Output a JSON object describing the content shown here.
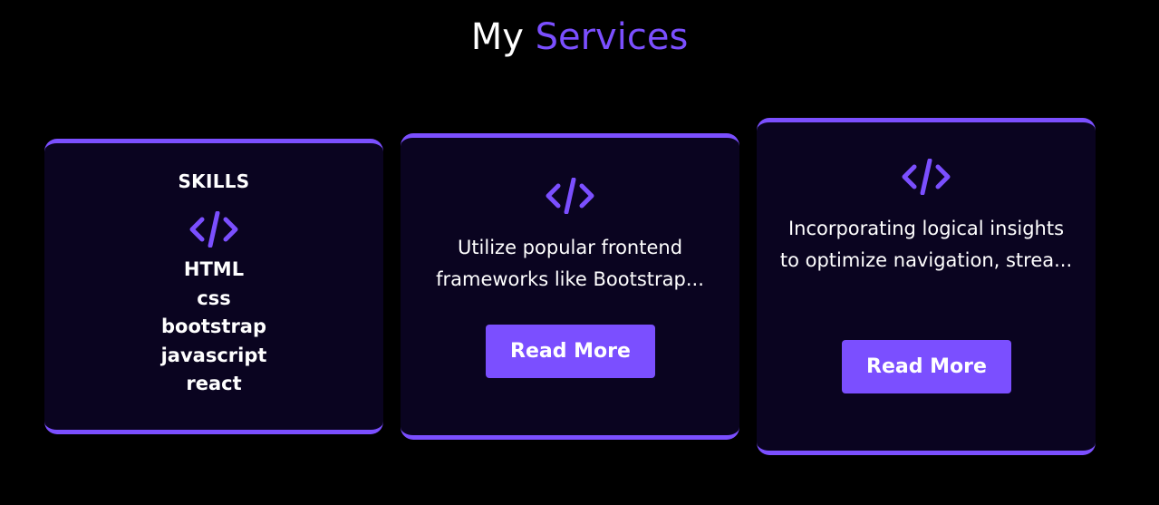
{
  "section": {
    "title_plain": "My ",
    "title_accent": "Services"
  },
  "colors": {
    "accent": "#7b4fff",
    "card_bg": "#0a0420",
    "page_bg": "#000000",
    "text": "#ffffff"
  },
  "cards": [
    {
      "icon": "code-icon",
      "title": "SKILLS",
      "skills": [
        "HTML",
        "css",
        "bootstrap",
        "javascript",
        "react"
      ]
    },
    {
      "icon": "code-icon",
      "description": "Utilize popular frontend frameworks like Bootstrap...",
      "button_label": "Read More"
    },
    {
      "icon": "code-icon",
      "description": "Incorporating logical insights to optimize navigation, strea...",
      "button_label": "Read More"
    }
  ]
}
